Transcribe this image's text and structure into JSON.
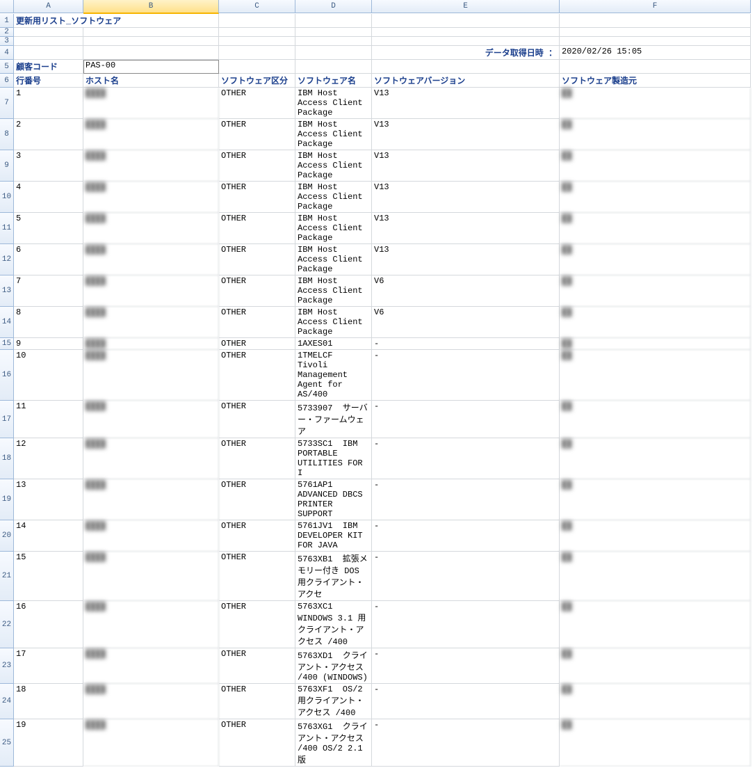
{
  "columns": [
    "A",
    "B",
    "C",
    "D",
    "E",
    "F"
  ],
  "selectedCol": 1,
  "title": "更新用リスト_ソフトウェア",
  "tsLabel": "データ取得日時 ：",
  "tsValue": "2020/02/26 15:05",
  "customerCodeLabel": "顧客コード",
  "customerCode": "PAS-00",
  "headers": {
    "rowNo": "行番号",
    "host": "ホスト名",
    "swKind": "ソフトウェア区分",
    "swName": "ソフトウェア名",
    "swVer": "ソフトウェアバージョン",
    "swVendor": "ソフトウェア製造元"
  },
  "rows": [
    {
      "n": "1",
      "host": "████",
      "kind": "OTHER",
      "name": "IBM Host Access Client Package",
      "ver": "V13",
      "vendor": "██"
    },
    {
      "n": "2",
      "host": "████",
      "kind": "OTHER",
      "name": "IBM Host Access Client Package",
      "ver": "V13",
      "vendor": "██"
    },
    {
      "n": "3",
      "host": "████",
      "kind": "OTHER",
      "name": "IBM Host Access Client Package",
      "ver": "V13",
      "vendor": "██"
    },
    {
      "n": "4",
      "host": "████",
      "kind": "OTHER",
      "name": "IBM Host Access Client Package",
      "ver": "V13",
      "vendor": "██"
    },
    {
      "n": "5",
      "host": "████",
      "kind": "OTHER",
      "name": "IBM Host Access Client Package",
      "ver": "V13",
      "vendor": "██"
    },
    {
      "n": "6",
      "host": "████",
      "kind": "OTHER",
      "name": "IBM Host Access Client Package",
      "ver": "V13",
      "vendor": "██"
    },
    {
      "n": "7",
      "host": "████",
      "kind": "OTHER",
      "name": "IBM Host Access Client Package",
      "ver": "V6",
      "vendor": "██"
    },
    {
      "n": "8",
      "host": "████",
      "kind": "OTHER",
      "name": "IBM Host Access Client Package",
      "ver": "V6",
      "vendor": "██"
    },
    {
      "n": "9",
      "host": "████",
      "kind": "OTHER",
      "name": "1AXES01",
      "ver": "-",
      "vendor": "██"
    },
    {
      "n": "10",
      "host": "████",
      "kind": "OTHER",
      "name": "1TMELCF  Tivoli Management Agent for AS/400",
      "ver": "-",
      "vendor": "██"
    },
    {
      "n": "11",
      "host": "████",
      "kind": "OTHER",
      "name": "5733907  サーバー・ファームウェア",
      "ver": "-",
      "vendor": "██"
    },
    {
      "n": "12",
      "host": "████",
      "kind": "OTHER",
      "name": "5733SC1  IBM PORTABLE UTILITIES FOR I",
      "ver": "-",
      "vendor": "██"
    },
    {
      "n": "13",
      "host": "████",
      "kind": "OTHER",
      "name": "5761AP1  ADVANCED DBCS PRINTER SUPPORT",
      "ver": "-",
      "vendor": "██"
    },
    {
      "n": "14",
      "host": "████",
      "kind": "OTHER",
      "name": "5761JV1  IBM DEVELOPER KIT FOR JAVA",
      "ver": "-",
      "vendor": "██"
    },
    {
      "n": "15",
      "host": "████",
      "kind": "OTHER",
      "name": "5763XB1  拡張メモリー付き DOS 用クライアント・アクセ",
      "ver": "-",
      "vendor": "██"
    },
    {
      "n": "16",
      "host": "████",
      "kind": "OTHER",
      "name": "5763XC1  WINDOWS 3.1 用クライアント・アクセス /400",
      "ver": "-",
      "vendor": "██"
    },
    {
      "n": "17",
      "host": "████",
      "kind": "OTHER",
      "name": "5763XD1  クライアント・アクセス /400 (WINDOWS)",
      "ver": "-",
      "vendor": "██"
    },
    {
      "n": "18",
      "host": "████",
      "kind": "OTHER",
      "name": "5763XF1  OS/2 用クライアント・アクセス /400",
      "ver": "-",
      "vendor": "██"
    },
    {
      "n": "19",
      "host": "████",
      "kind": "OTHER",
      "name": "5763XG1  クライアント・アクセス /400 OS/2 2.1 版",
      "ver": "-",
      "vendor": "██"
    }
  ],
  "excelRowMap": [
    1,
    2,
    3,
    4,
    5,
    6,
    7,
    8,
    9,
    10,
    11,
    12,
    13,
    14,
    15,
    16,
    17,
    18,
    19,
    20,
    21,
    22,
    23,
    24,
    25
  ]
}
